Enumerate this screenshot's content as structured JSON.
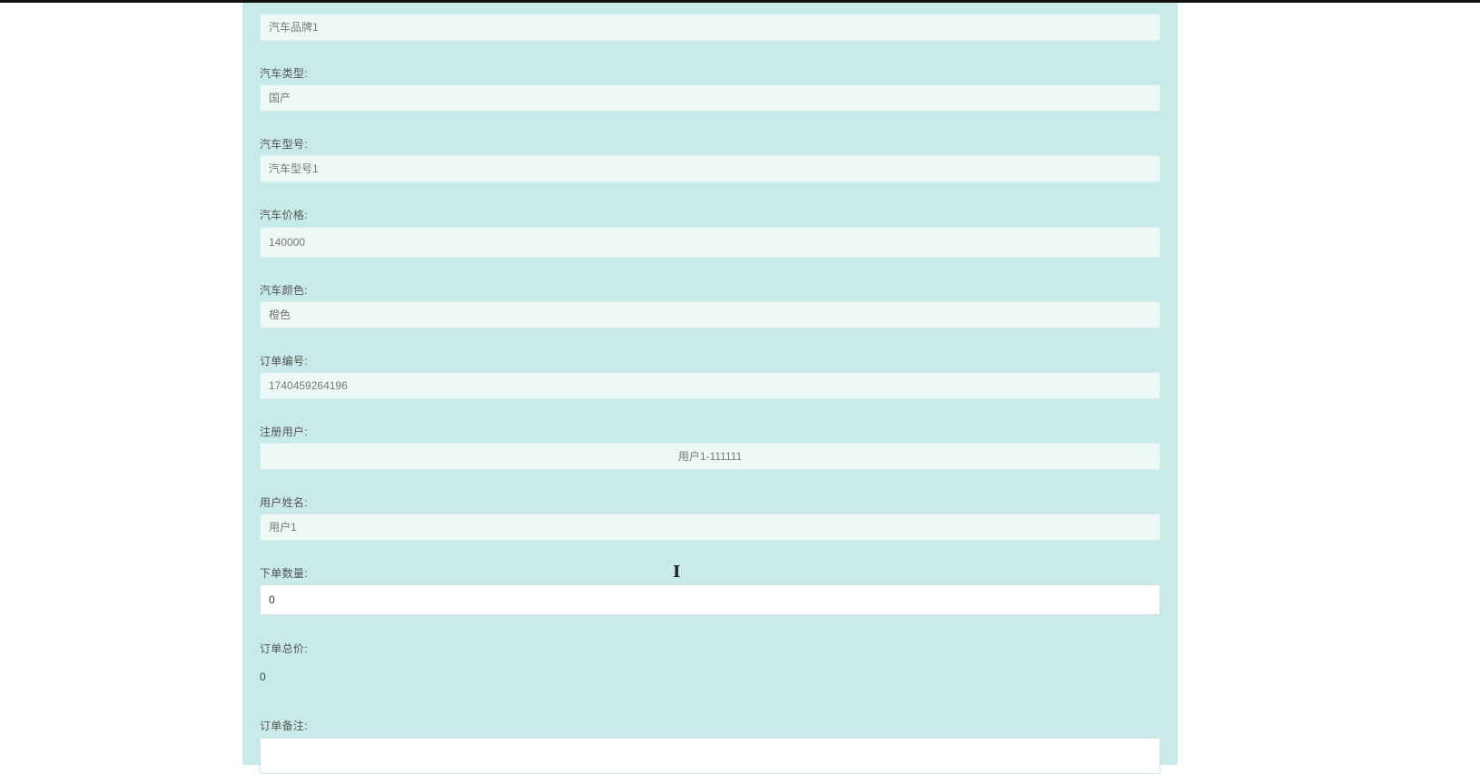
{
  "fields": {
    "brand": {
      "value": "汽车品牌1"
    },
    "type": {
      "label": "汽车类型:",
      "value": "国产"
    },
    "model": {
      "label": "汽车型号:",
      "value": "汽车型号1"
    },
    "price": {
      "label": "汽车价格:",
      "value": "140000"
    },
    "color": {
      "label": "汽车颜色:",
      "value": "橙色"
    },
    "order_no": {
      "label": "订单编号:",
      "value": "1740459264196"
    },
    "user": {
      "label": "注册用户:",
      "value": "用户1-111111"
    },
    "username": {
      "label": "用户姓名:",
      "value": "用户1"
    },
    "quantity": {
      "label": "下单数量:",
      "value": "0"
    },
    "total": {
      "label": "订单总价:",
      "value": "0"
    },
    "remark": {
      "label": "订单备注:",
      "value": ""
    }
  }
}
